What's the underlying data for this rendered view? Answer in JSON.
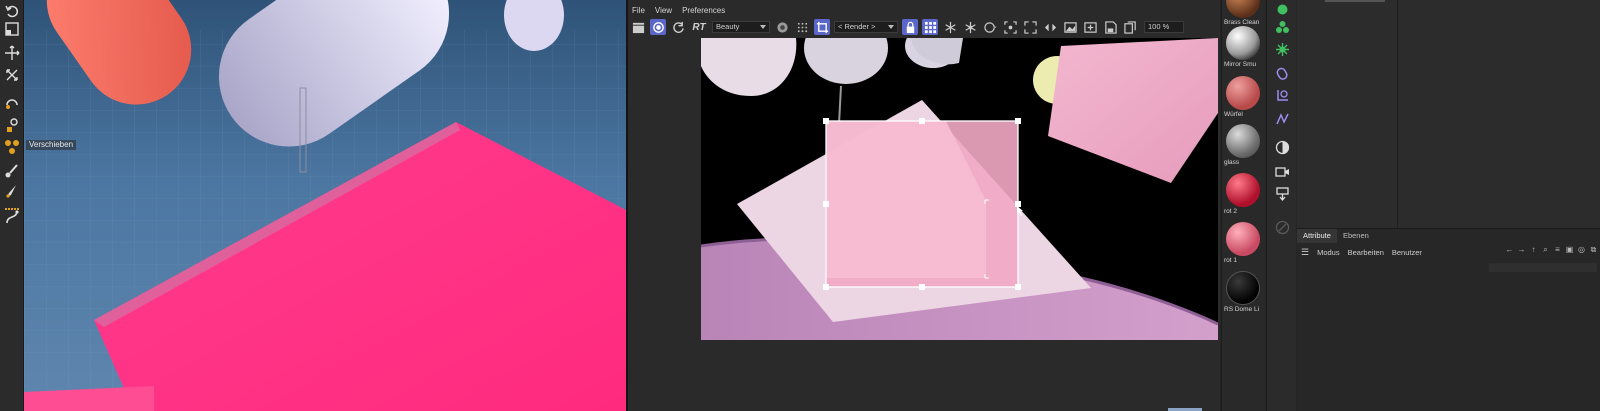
{
  "viewport": {
    "tooltip": "Verschieben",
    "tools": [
      "undo-icon",
      "scale-icon",
      "move-icon",
      "rotate-icon",
      "lasso-icon",
      "pen-icon",
      "nodes-icon",
      "brush-icon",
      "knife-icon",
      "spline-icon",
      "bend-icon"
    ]
  },
  "picture_viewer": {
    "menu": [
      "File",
      "View",
      "Preferences"
    ],
    "rt_label": "RT",
    "pass_dropdown": "Beauty",
    "render_dropdown": "< Render >",
    "zoom": "100 %"
  },
  "materials": [
    {
      "name": "Brass Clean",
      "color": "#7a4a2e"
    },
    {
      "name": "Mirror Smu",
      "color": "#bdbdbd"
    },
    {
      "name": "Würfel",
      "color": "#c96565"
    },
    {
      "name": "glass",
      "color": "#8f8f8f"
    },
    {
      "name": "rot 2",
      "color": "#c0203a"
    },
    {
      "name": "rot 1",
      "color": "#d95c70"
    },
    {
      "name": "RS Dome Li",
      "color": "#0a0a0a"
    }
  ],
  "attribute_panel": {
    "tabs": [
      "Attribute",
      "Ebenen"
    ],
    "menu": [
      "Modus",
      "Bearbeiten",
      "Benutzer"
    ]
  },
  "colors": {
    "accent": "#5a67c9",
    "viewport_sky": "#4c77a2",
    "cube_pink": "#ff3a8c"
  }
}
